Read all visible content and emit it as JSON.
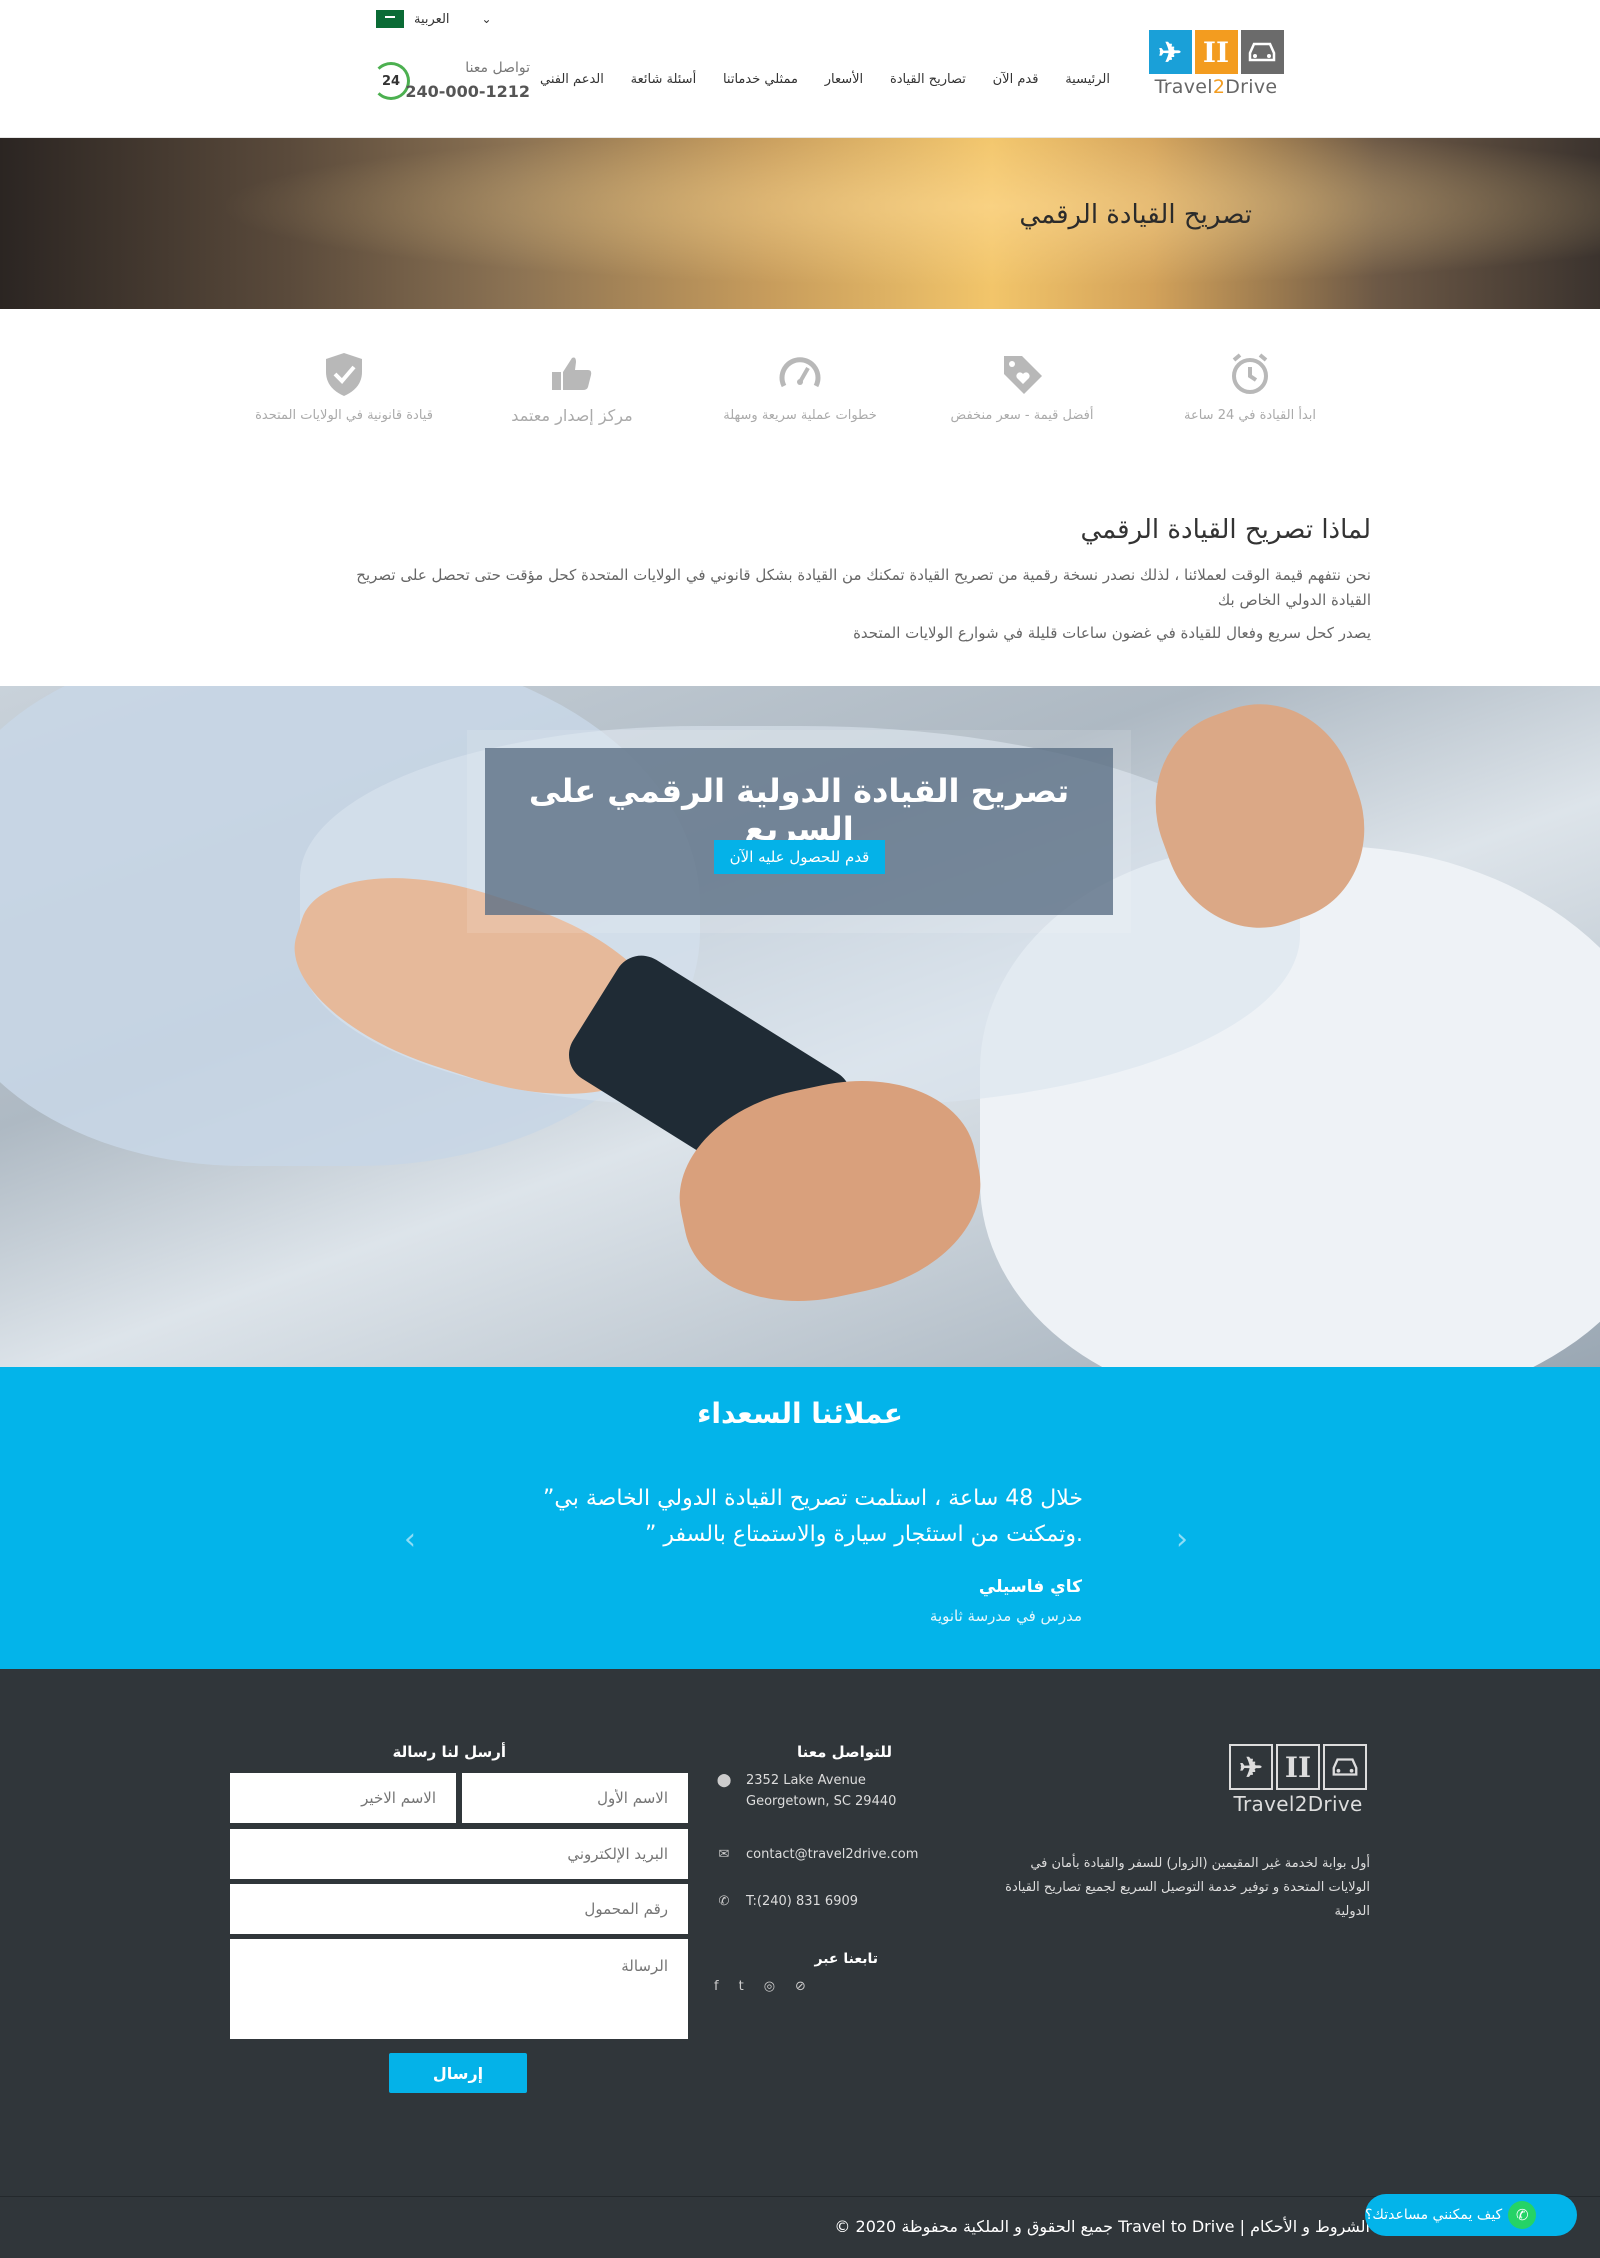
{
  "header": {
    "language": "العربية",
    "logo": {
      "text_part1": "Travel",
      "text_part2": "2",
      "text_part3": "Drive"
    },
    "nav": [
      "الرئيسية",
      "قدم الآن",
      "تصاريح القيادة",
      "الأسعار",
      "ممثلي خدماتنا",
      "أسئلة شائعة",
      "الدعم الفني"
    ],
    "contact_label": "تواصل معنا",
    "contact_phone": "240-000-1212",
    "phone_badge": "24"
  },
  "hero": {
    "title": "تصريح القيادة الرقمي"
  },
  "features": [
    {
      "icon": "alarm-clock-icon",
      "label": "ابدأ القيادة في 24 ساعة"
    },
    {
      "icon": "price-tag-heart-icon",
      "label": "أفضل قيمة - سعر منخفض"
    },
    {
      "icon": "speedometer-icon",
      "label": "خطوات عملية سريعة وسهلة"
    },
    {
      "icon": "thumbs-up-icon",
      "label": "مركز إصدار معتمد"
    },
    {
      "icon": "shield-check-icon",
      "label": "قيادة قانونية في الولايات المتحدة"
    }
  ],
  "why": {
    "title": "لماذا تصريح القيادة الرقمي",
    "p1": "نحن نتفهم قيمة الوقت لعملائنا ، لذلك نصدر نسخة رقمية من تصريح القيادة تمكنك من القيادة بشكل قانوني في الولايات المتحدة كحل مؤقت حتى تحصل على تصريح القيادة الدولي الخاص بك",
    "p2": "يصدر كحل سريع وفعال للقيادة في غضون ساعات قليلة في شوارع الولايات المتحدة"
  },
  "promo": {
    "title": "تصريح القيادة الدولية الرقمي على السريع",
    "button": "قدم للحصول عليه الآن"
  },
  "testimonials": {
    "title": "عملائنا السعداء",
    "quote": "خلال 48 ساعة ، استلمت تصريح القيادة الدولي الخاصة بي” .وتمكنت من استئجار سيارة والاستمتاع بالسفر ”",
    "author": "كاي فاسيلي",
    "role": "مدرس في مدرسة ثانوية",
    "prev": "‹",
    "next": "›"
  },
  "footer": {
    "about": "أول بوابة لخدمة غير المقيمين (الزوار) للسفر والقيادة بأمان في الولايات المتحدة و توفير خدمة التوصيل السريع لجميع تصاريح القيادة الدولية",
    "contact_title": "للتواصل معنا",
    "address_line1": "2352 Lake Avenue",
    "address_line2": "Georgetown, SC 29440",
    "email": "contact@travel2drive.com",
    "phone": "T:(240) 831 6909",
    "follow_title": "تابعنا عبر",
    "social": [
      "f",
      "t",
      "◎",
      "⊘"
    ],
    "form_title": "أرسل لنا رسالة",
    "first_name": "الاسم الأول",
    "last_name": "الاسم الاخير",
    "email_ph": "البريد الإلكتروني",
    "mobile_ph": "رقم المحمول",
    "message_ph": "الرسالة",
    "send": "إرسال",
    "copyright": "الشروط و الأحكام | Travel to Drive جميع الحقوق و الملكية محفوظة 2020 ©",
    "whatsapp": "كيف يمكنني مساعدتك؟"
  },
  "colors": {
    "accent": "#03b4ea",
    "footer_bg": "#30363a",
    "logo_blue": "#1aa0d8",
    "logo_orange": "#f39c1f",
    "logo_gray": "#6b6b6b"
  }
}
